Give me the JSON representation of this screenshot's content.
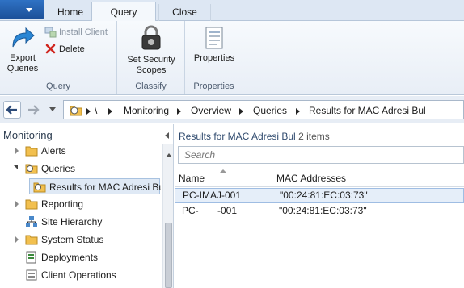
{
  "ribbon": {
    "tabs": [
      "Home",
      "Query",
      "Close"
    ],
    "groups": {
      "query": {
        "title": "Query",
        "export_label_1": "Export",
        "export_label_2": "Queries",
        "install_client": "Install Client",
        "delete": "Delete"
      },
      "classify": {
        "title": "Classify",
        "set_security_1": "Set Security",
        "set_security_2": "Scopes"
      },
      "properties": {
        "title": "Properties",
        "properties_label": "Properties"
      }
    }
  },
  "address": {
    "root": "\\",
    "crumbs": [
      "Monitoring",
      "Overview",
      "Queries",
      "Results for MAC Adresi Bul"
    ]
  },
  "nav": {
    "title": "Monitoring",
    "items": [
      {
        "label": "Alerts"
      },
      {
        "label": "Queries"
      },
      {
        "label": "Results for MAC Adresi Bu"
      },
      {
        "label": "Reporting"
      },
      {
        "label": "Site Hierarchy"
      },
      {
        "label": "System Status"
      },
      {
        "label": "Deployments"
      },
      {
        "label": "Client Operations"
      }
    ]
  },
  "content": {
    "title": "Results for MAC Adresi Bul",
    "count": "2 items",
    "search_placeholder": "Search",
    "columns": [
      "Name",
      "MAC Addresses"
    ],
    "rows": [
      {
        "name": "PC-IMAJ-001",
        "mac": "\"00:24:81:EC:03:73\""
      },
      {
        "name": "PC-       -001",
        "mac": "\"00:24:81:EC:03:73\""
      }
    ]
  },
  "colors": {
    "accent": "#1f5ca8",
    "selection": "#e5eef9"
  }
}
